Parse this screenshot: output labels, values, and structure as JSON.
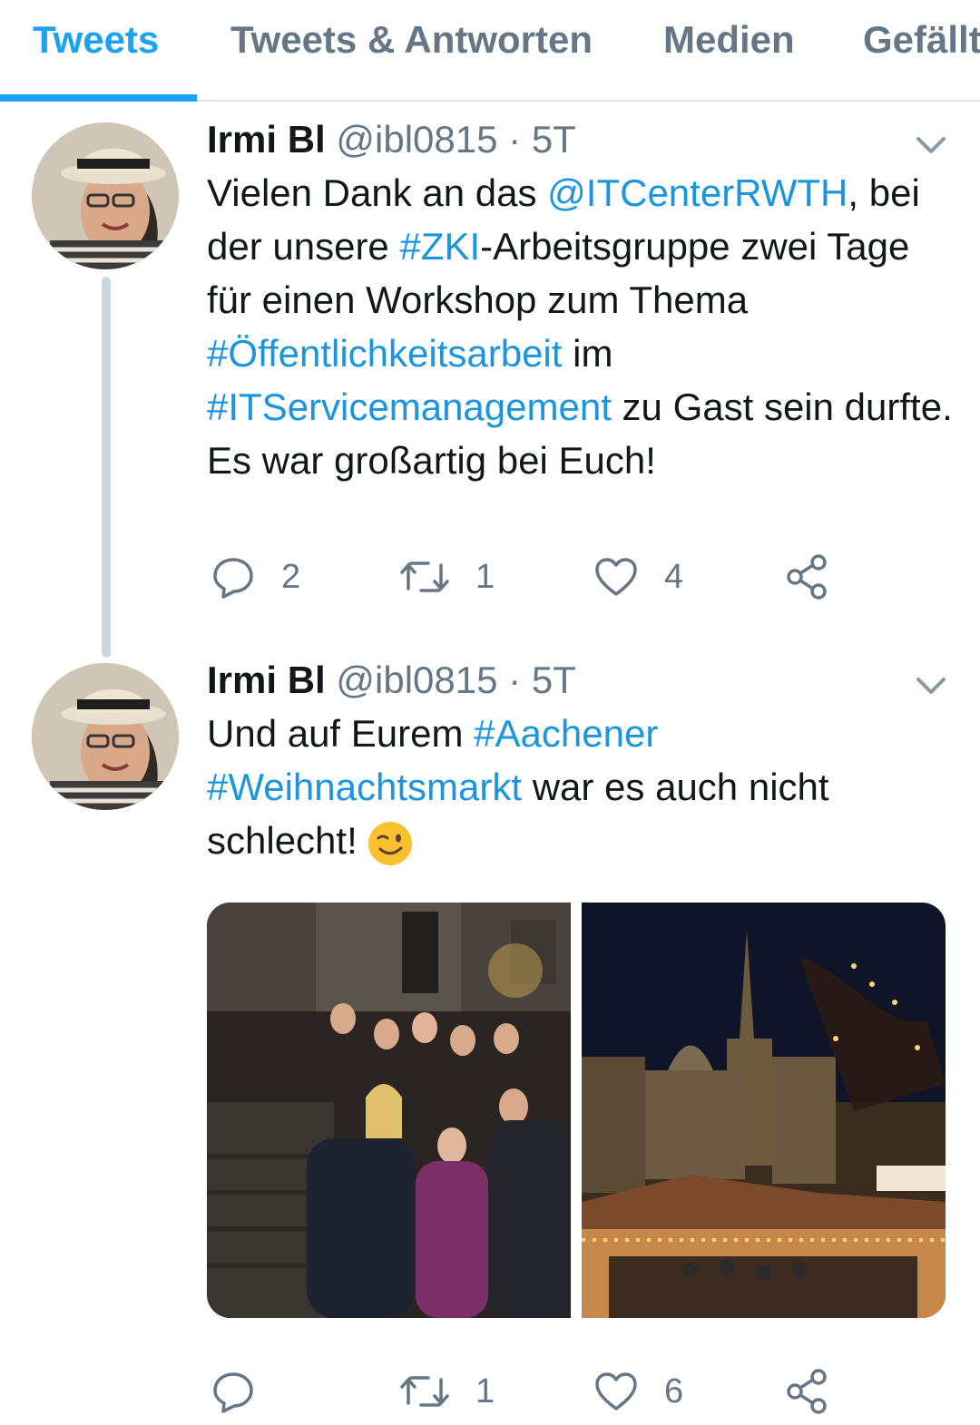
{
  "tabs": [
    {
      "label": "Tweets",
      "active": true
    },
    {
      "label": "Tweets & Antworten",
      "active": false
    },
    {
      "label": "Medien",
      "active": false
    },
    {
      "label": "Gefällt"
    }
  ],
  "tweets": [
    {
      "name": "Irmi Bl",
      "handle": "@ibl0815",
      "dot": "·",
      "time": "5T",
      "text_parts": {
        "p1": "Vielen Dank an das ",
        "l1": "@ITCenterRWTH",
        "p2": ", bei der unsere ",
        "l2": "#ZKI",
        "p3": "-Arbeitsgruppe zwei Tage für einen Workshop zum Thema ",
        "l3": "#Öffentlichkeitsarbeit",
        "p4": " im ",
        "l4": "#ITServicemanagement",
        "p5": " zu Gast sein durfte. Es war großartig bei Euch!"
      },
      "replies": "2",
      "retweets": "1",
      "likes": "4"
    },
    {
      "name": "Irmi Bl",
      "handle": "@ibl0815",
      "dot": "·",
      "time": "5T",
      "text_parts": {
        "p1": "Und auf Eurem ",
        "l1": "#Aachener",
        "p2": " ",
        "l2": "#Weihnachtsmarkt",
        "p3": " war es auch nicht schlecht!"
      },
      "emoji": "winking-face",
      "retweets": "1",
      "likes": "6"
    }
  ],
  "colors": {
    "accent": "#1da1f2",
    "link": "#1b95e0",
    "secondary_text": "#657786",
    "divider": "#e1e8ed"
  }
}
